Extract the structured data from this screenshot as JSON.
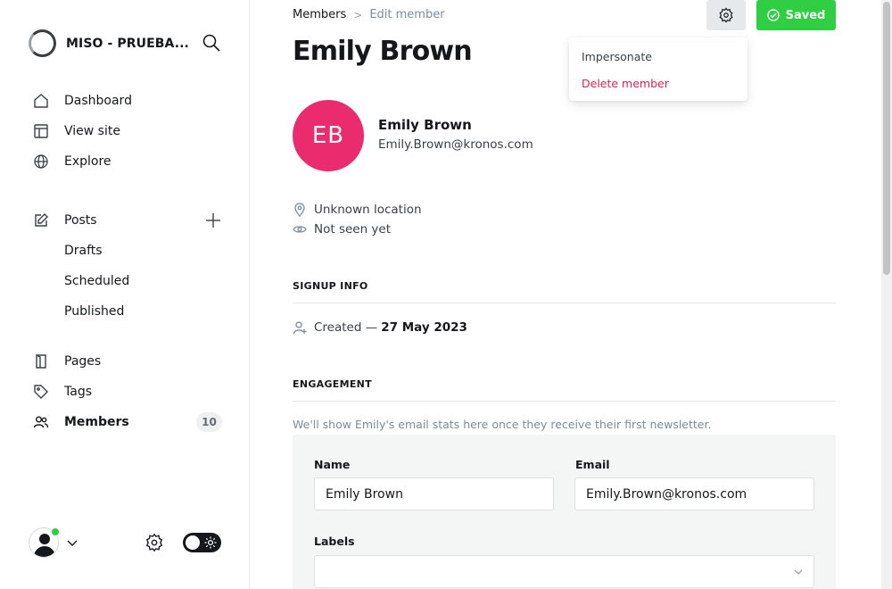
{
  "sidebar": {
    "brand_name": "MISO - PRUEBA...",
    "nav_main": [
      {
        "label": "Dashboard",
        "icon": "house-icon"
      },
      {
        "label": "View site",
        "icon": "layout-icon"
      },
      {
        "label": "Explore",
        "icon": "globe-icon"
      }
    ],
    "posts": {
      "label": "Posts",
      "icon": "pen-square-icon",
      "sub": [
        "Drafts",
        "Scheduled",
        "Published"
      ]
    },
    "nav_content": [
      {
        "label": "Pages",
        "icon": "page-icon"
      },
      {
        "label": "Tags",
        "icon": "tag-icon"
      },
      {
        "label": "Members",
        "icon": "members-icon",
        "count": "10",
        "active": true
      }
    ]
  },
  "header": {
    "breadcrumb_parent": "Members",
    "breadcrumb_current": "Edit member",
    "saved_label": "Saved",
    "title": "Emily Brown"
  },
  "dropdown": {
    "impersonate": "Impersonate",
    "delete": "Delete member"
  },
  "member": {
    "initials": "EB",
    "name": "Emily Brown",
    "email": "Emily.Brown@kronos.com",
    "location": "Unknown location",
    "seen": "Not seen yet",
    "avatar_color": "#ea2c6f"
  },
  "signup": {
    "section_title": "SIGNUP INFO",
    "created_prefix": "Created —",
    "created_date": "27 May 2023"
  },
  "engagement": {
    "section_title": "ENGAGEMENT",
    "note": "We'll show Emily's email stats here once they receive their first newsletter."
  },
  "form": {
    "name_label": "Name",
    "name_value": "Emily Brown",
    "email_label": "Email",
    "email_value": "Emily.Brown@kronos.com",
    "labels_label": "Labels"
  },
  "colors": {
    "accent_green": "#30cf43",
    "danger": "#e0224b"
  }
}
